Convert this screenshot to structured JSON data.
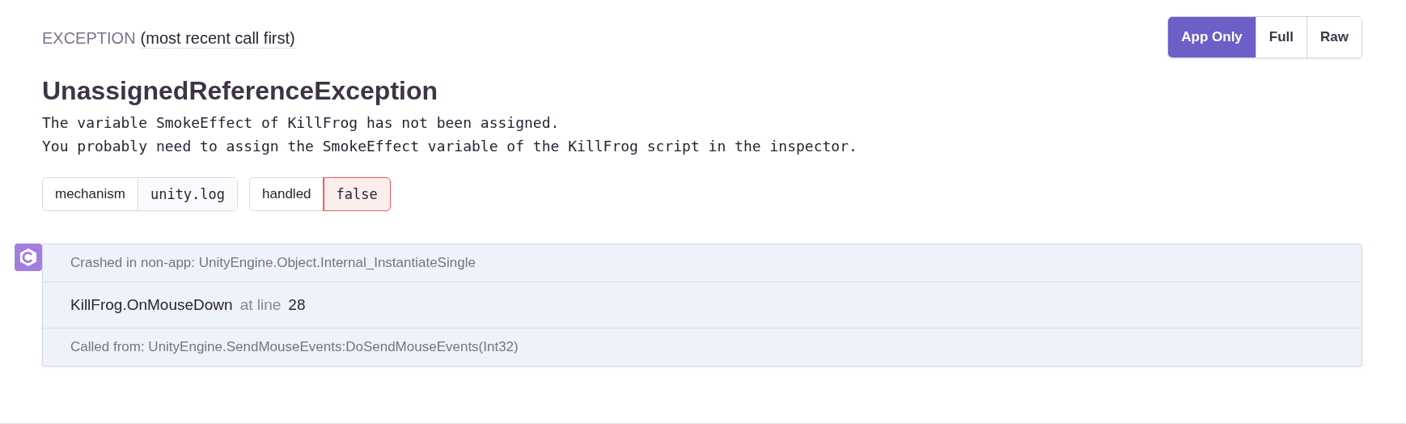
{
  "header": {
    "title": "EXCEPTION",
    "subtitle": "(most recent call first)"
  },
  "view_modes": [
    {
      "label": "App Only",
      "selected": true
    },
    {
      "label": "Full",
      "selected": false
    },
    {
      "label": "Raw",
      "selected": false
    }
  ],
  "exception": {
    "type": "UnassignedReferenceException",
    "message": [
      "The variable SmokeEffect of KillFrog has not been assigned.",
      "You probably need to assign the SmokeEffect variable of the KillFrog script in the inspector."
    ]
  },
  "tags": [
    {
      "key": "mechanism",
      "value": "unity.log",
      "error": false
    },
    {
      "key": "handled",
      "value": "false",
      "error": true
    }
  ],
  "frames": [
    {
      "kind": "note",
      "text": "Crashed in non-app: UnityEngine.Object.Internal_InstantiateSingle"
    },
    {
      "kind": "frame",
      "function": "KillFrog.OnMouseDown",
      "at": "at line",
      "line": "28"
    },
    {
      "kind": "note",
      "text": "Called from: UnityEngine.SendMouseEvents:DoSendMouseEvents(Int32)"
    }
  ]
}
